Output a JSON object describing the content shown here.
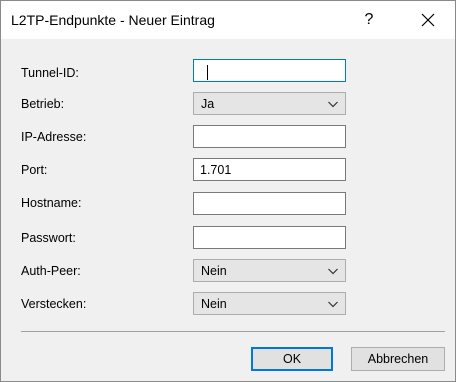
{
  "window": {
    "title": "L2TP-Endpunkte - Neuer Eintrag",
    "help_label": "?"
  },
  "form": {
    "tunnel_id": {
      "label": "Tunnel-ID:",
      "value": ""
    },
    "betrieb": {
      "label": "Betrieb:",
      "value": "Ja"
    },
    "ip_adresse": {
      "label": "IP-Adresse:",
      "value": ""
    },
    "port": {
      "label": "Port:",
      "value": "1.701"
    },
    "hostname": {
      "label": "Hostname:",
      "value": ""
    },
    "passwort": {
      "label": "Passwort:",
      "value": ""
    },
    "auth_peer": {
      "label": "Auth-Peer:",
      "value": "Nein"
    },
    "verstecken": {
      "label": "Verstecken:",
      "value": "Nein"
    }
  },
  "buttons": {
    "ok": "OK",
    "cancel": "Abbrechen"
  },
  "icons": {
    "close": "close-icon",
    "dropdown": "chevron-down-icon"
  },
  "colors": {
    "focus": "#0078d7",
    "dialog_bg": "#f0f0f0"
  }
}
